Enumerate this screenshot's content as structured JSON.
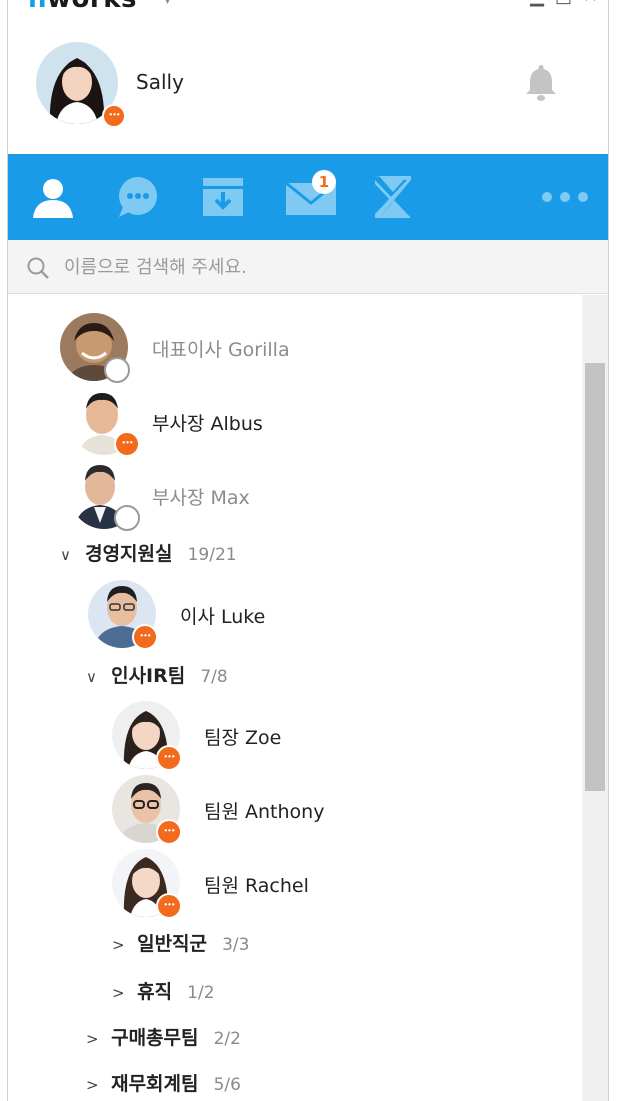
{
  "app": {
    "title_prefix": "n",
    "title_rest": "works",
    "caret": "▾"
  },
  "window_controls": {
    "minimize": "▁",
    "maximize": "□",
    "close": "✕"
  },
  "profile": {
    "name": "Sally",
    "status": "busy"
  },
  "tabs": [
    {
      "id": "contacts",
      "icon": "person-icon",
      "active": true
    },
    {
      "id": "chat",
      "icon": "chat-bubble-icon"
    },
    {
      "id": "inbox",
      "icon": "tray-download-icon"
    },
    {
      "id": "mail",
      "icon": "envelope-icon",
      "badge": "1"
    },
    {
      "id": "tasks",
      "icon": "x-hourglass-icon"
    },
    {
      "id": "more",
      "icon": "more-dots-icon"
    }
  ],
  "search": {
    "placeholder": "이름으로 검색해 주세요."
  },
  "list": {
    "gorilla": {
      "name": "대표이사 Gorilla",
      "status": "offline"
    },
    "albus": {
      "name": "부사장 Albus",
      "status": "busy"
    },
    "max": {
      "name": "부사장 Max",
      "status": "offline"
    },
    "group_mgmt": {
      "name": "경영지원실",
      "count": "19/21",
      "chevron": "∨"
    },
    "luke": {
      "name": "이사 Luke",
      "status": "busy"
    },
    "group_hr": {
      "name": "인사IR팀",
      "count": "7/8",
      "chevron": "∨"
    },
    "zoe": {
      "name": "팀장 Zoe",
      "status": "busy"
    },
    "anthony": {
      "name": "팀원 Anthony",
      "status": "busy"
    },
    "rachel": {
      "name": "팀원 Rachel",
      "status": "busy"
    },
    "group_general": {
      "name": "일반직군",
      "count": "3/3",
      "chevron": ">"
    },
    "group_leave": {
      "name": "휴직",
      "count": "1/2",
      "chevron": ">"
    },
    "group_purchase": {
      "name": "구매총무팀",
      "count": "2/2",
      "chevron": ">"
    },
    "group_finance": {
      "name": "재무회계팀",
      "count": "5/6",
      "chevron": ">"
    }
  },
  "colors": {
    "accent": "#1a9be8",
    "busy": "#f26a1b",
    "offline_text": "#8c8c8c"
  }
}
